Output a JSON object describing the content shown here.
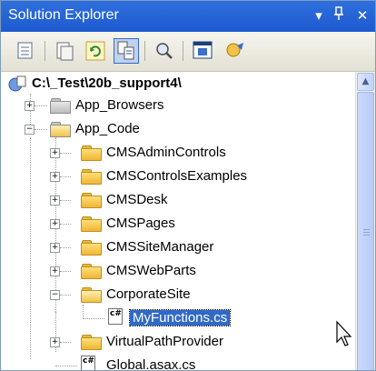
{
  "window": {
    "title": "Solution Explorer",
    "controls": {
      "dropdown": "▾",
      "pin": "ᵠ",
      "close": "✕"
    }
  },
  "toolbar": {
    "icons": [
      "properties-icon",
      "show-all-files-icon",
      "refresh-icon",
      "nest-related-files-icon",
      "view-code-icon",
      "view-designer-icon",
      "copy-website-icon"
    ]
  },
  "tree": {
    "root": "C:\\_Test\\20b_support4\\",
    "items": [
      {
        "label": "App_Browsers"
      },
      {
        "label": "App_Code"
      },
      {
        "label": "CMSAdminControls"
      },
      {
        "label": "CMSControlsExamples"
      },
      {
        "label": "CMSDesk"
      },
      {
        "label": "CMSPages"
      },
      {
        "label": "CMSSiteManager"
      },
      {
        "label": "CMSWebParts"
      },
      {
        "label": "CorporateSite"
      },
      {
        "label": "MyFunctions.cs"
      },
      {
        "label": "VirtualPathProvider"
      },
      {
        "label": "Global.asax.cs"
      }
    ],
    "file_badge": "c#"
  },
  "colors": {
    "titlebar": "#2563d7",
    "selection": "#316ac5",
    "folder": "#f0b634"
  }
}
